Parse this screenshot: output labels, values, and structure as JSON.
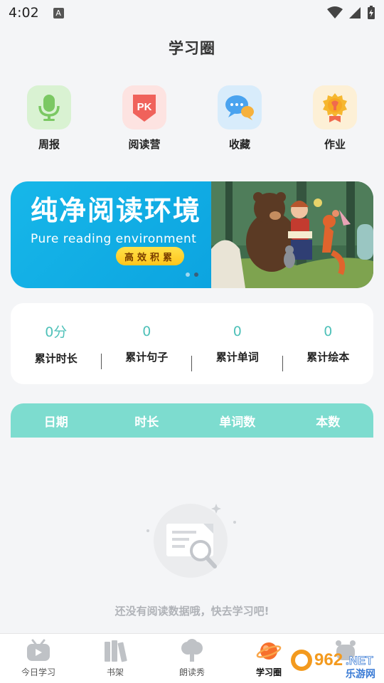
{
  "status_bar": {
    "time": "4:02",
    "badge": "A"
  },
  "header": {
    "title": "学习圈"
  },
  "quick_actions": [
    {
      "label": "周报",
      "icon": "microphone-icon",
      "bg": "#d9f2d2"
    },
    {
      "label": "阅读营",
      "icon": "pk-shield-icon",
      "bg": "#fde3e1"
    },
    {
      "label": "收藏",
      "icon": "chat-bubbles-icon",
      "bg": "#d8ecfb"
    },
    {
      "label": "作业",
      "icon": "medal-icon",
      "bg": "#fdf0d6"
    }
  ],
  "banner": {
    "title": "纯净阅读环境",
    "subtitle": "Pure reading environment",
    "button_label": "高效积累",
    "colors": {
      "bg": "#17b7e9",
      "button": "#ffcf2f"
    }
  },
  "stats": [
    {
      "value": "0分",
      "label": "累计时长"
    },
    {
      "value": "0",
      "label": "累计句子"
    },
    {
      "value": "0",
      "label": "累计单词"
    },
    {
      "value": "0",
      "label": "累计绘本"
    }
  ],
  "table": {
    "columns": [
      "日期",
      "时长",
      "单词数",
      "本数"
    ],
    "header_color": "#7ddccf"
  },
  "empty_state": {
    "message": "还没有阅读数据哦，快去学习吧!",
    "icon": "document-search-icon"
  },
  "bottom_nav": [
    {
      "label": "今日学习",
      "icon": "tv-icon",
      "active": false
    },
    {
      "label": "书架",
      "icon": "books-icon",
      "active": false
    },
    {
      "label": "朗读秀",
      "icon": "tree-icon",
      "active": false
    },
    {
      "label": "学习圈",
      "icon": "planet-icon",
      "active": true
    },
    {
      "label": "",
      "icon": "robot-icon",
      "active": false
    }
  ],
  "watermark": {
    "text_top": "962.NET",
    "text_bottom": "乐游网"
  }
}
